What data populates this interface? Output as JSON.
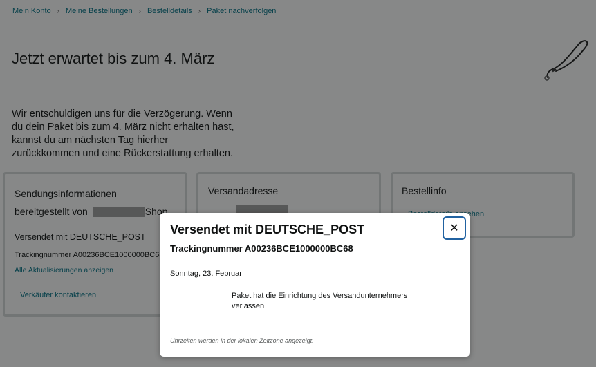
{
  "breadcrumb": {
    "items": [
      "Mein Konto",
      "Meine Bestellungen",
      "Bestelldetails",
      "Paket nachverfolgen"
    ],
    "separator": "›"
  },
  "headline": "Jetzt erwartet bis zum 4. März",
  "apology_lines": [
    "Wir entschuldigen uns für die Verzögerung. Wenn",
    "du dein Paket bis zum 4. März nicht erhalten hast,",
    "kannst du am nächsten Tag hierher",
    "zurückkommen und eine Rückerstattung erhalten."
  ],
  "shipment_card": {
    "title_line1": "Sendungsinformationen",
    "title_line2_prefix": "bereitgestellt von",
    "title_line2_suffix": "Shop",
    "shipped_with": "Versendet mit DEUTSCHE_POST",
    "tracking": "Trackingnummer A00236BCE1000000BC68",
    "all_updates_link": "Alle Aktualisierungen anzeigen",
    "contact_seller": "Verkäufer kontaktieren"
  },
  "address_card": {
    "title": "Versandadresse"
  },
  "order_card": {
    "title": "Bestellinfo",
    "link": "Bestelldetails ansehen"
  },
  "modal": {
    "title": "Versendet mit DEUTSCHE_POST",
    "tracking": "Trackingnummer A00236BCE1000000BC68",
    "date": "Sonntag, 23. Februar",
    "event_line1": "Paket hat die Einrichtung des Versandunternehmers",
    "event_line2": "verlassen",
    "footer": "Uhrzeiten werden in der lokalen Zeitzone angezeigt.",
    "close_symbol": "✕"
  },
  "icons": {
    "close": "close-icon",
    "product_image": "phone-lanyard-image"
  },
  "colors": {
    "link": "#007185",
    "focus_ring": "#2162a1",
    "redaction": "#9e9e9e"
  }
}
